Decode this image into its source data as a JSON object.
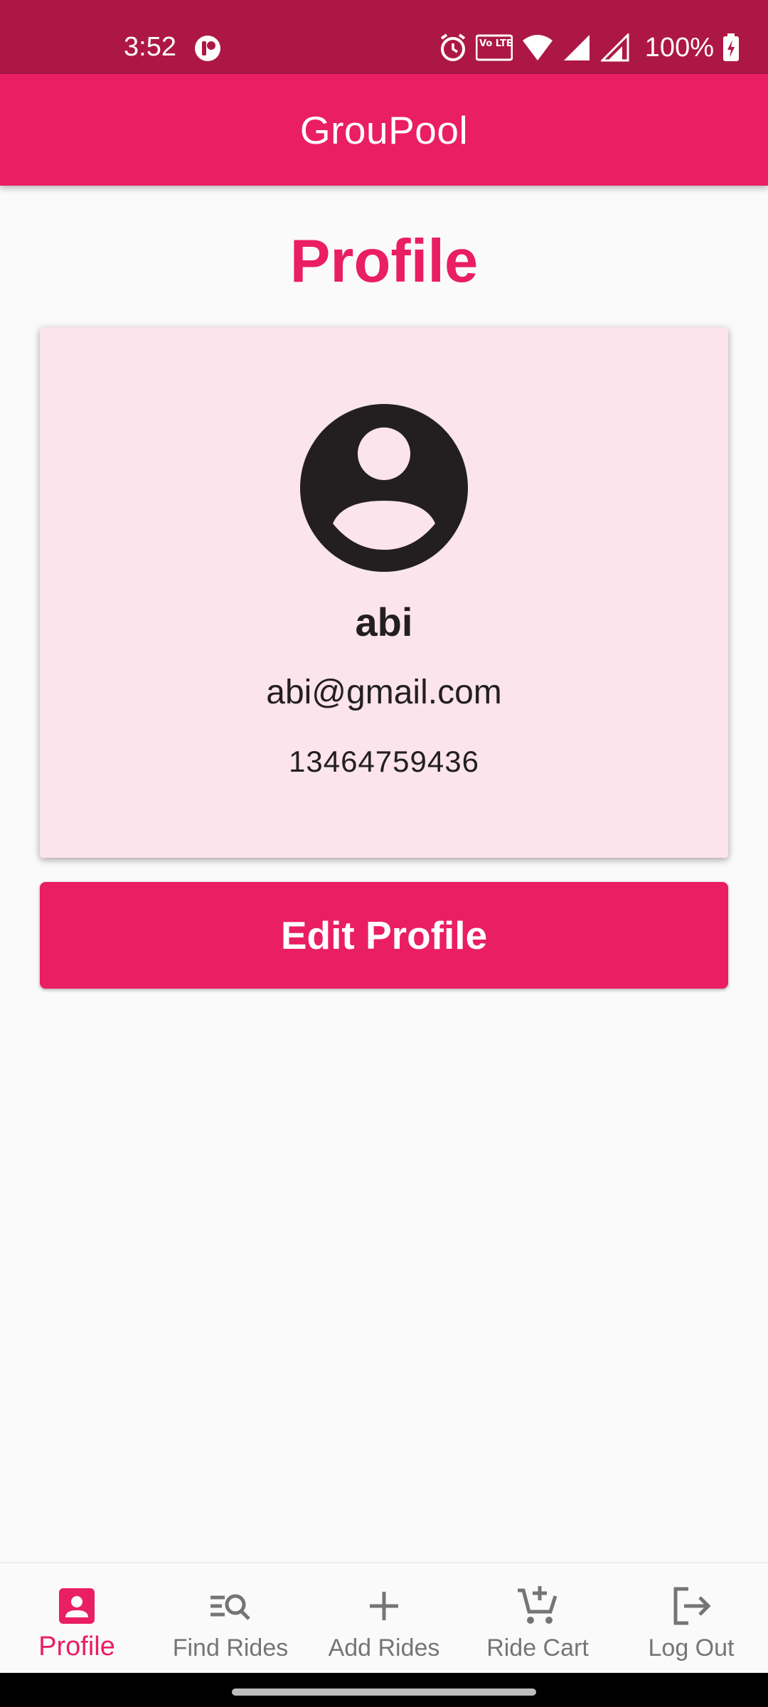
{
  "status_bar": {
    "time": "3:52",
    "battery": "100%",
    "icons": [
      "app-notification-icon",
      "alarm-icon",
      "volte-icon",
      "wifi-icon",
      "signal-icon",
      "signal-roaming-icon",
      "battery-charging-icon"
    ],
    "volte_label": "Vo LTE 1"
  },
  "app_bar": {
    "title": "GrouPool"
  },
  "page": {
    "title": "Profile"
  },
  "profile": {
    "avatar_icon": "account-circle-icon",
    "name": "abi",
    "email": "abi@gmail.com",
    "phone": "13464759436"
  },
  "actions": {
    "edit_label": "Edit Profile"
  },
  "bottom_nav": {
    "items": [
      {
        "label": "Profile",
        "icon": "person-icon",
        "active": true
      },
      {
        "label": "Find Rides",
        "icon": "search-list-icon",
        "active": false
      },
      {
        "label": "Add Rides",
        "icon": "plus-icon",
        "active": false
      },
      {
        "label": "Ride Cart",
        "icon": "cart-add-icon",
        "active": false
      },
      {
        "label": "Log Out",
        "icon": "logout-icon",
        "active": false
      }
    ]
  },
  "colors": {
    "primary": "#ea1e63",
    "status_bar": "#ad1746",
    "card_background": "#fbe4ec",
    "inactive": "#757575"
  }
}
